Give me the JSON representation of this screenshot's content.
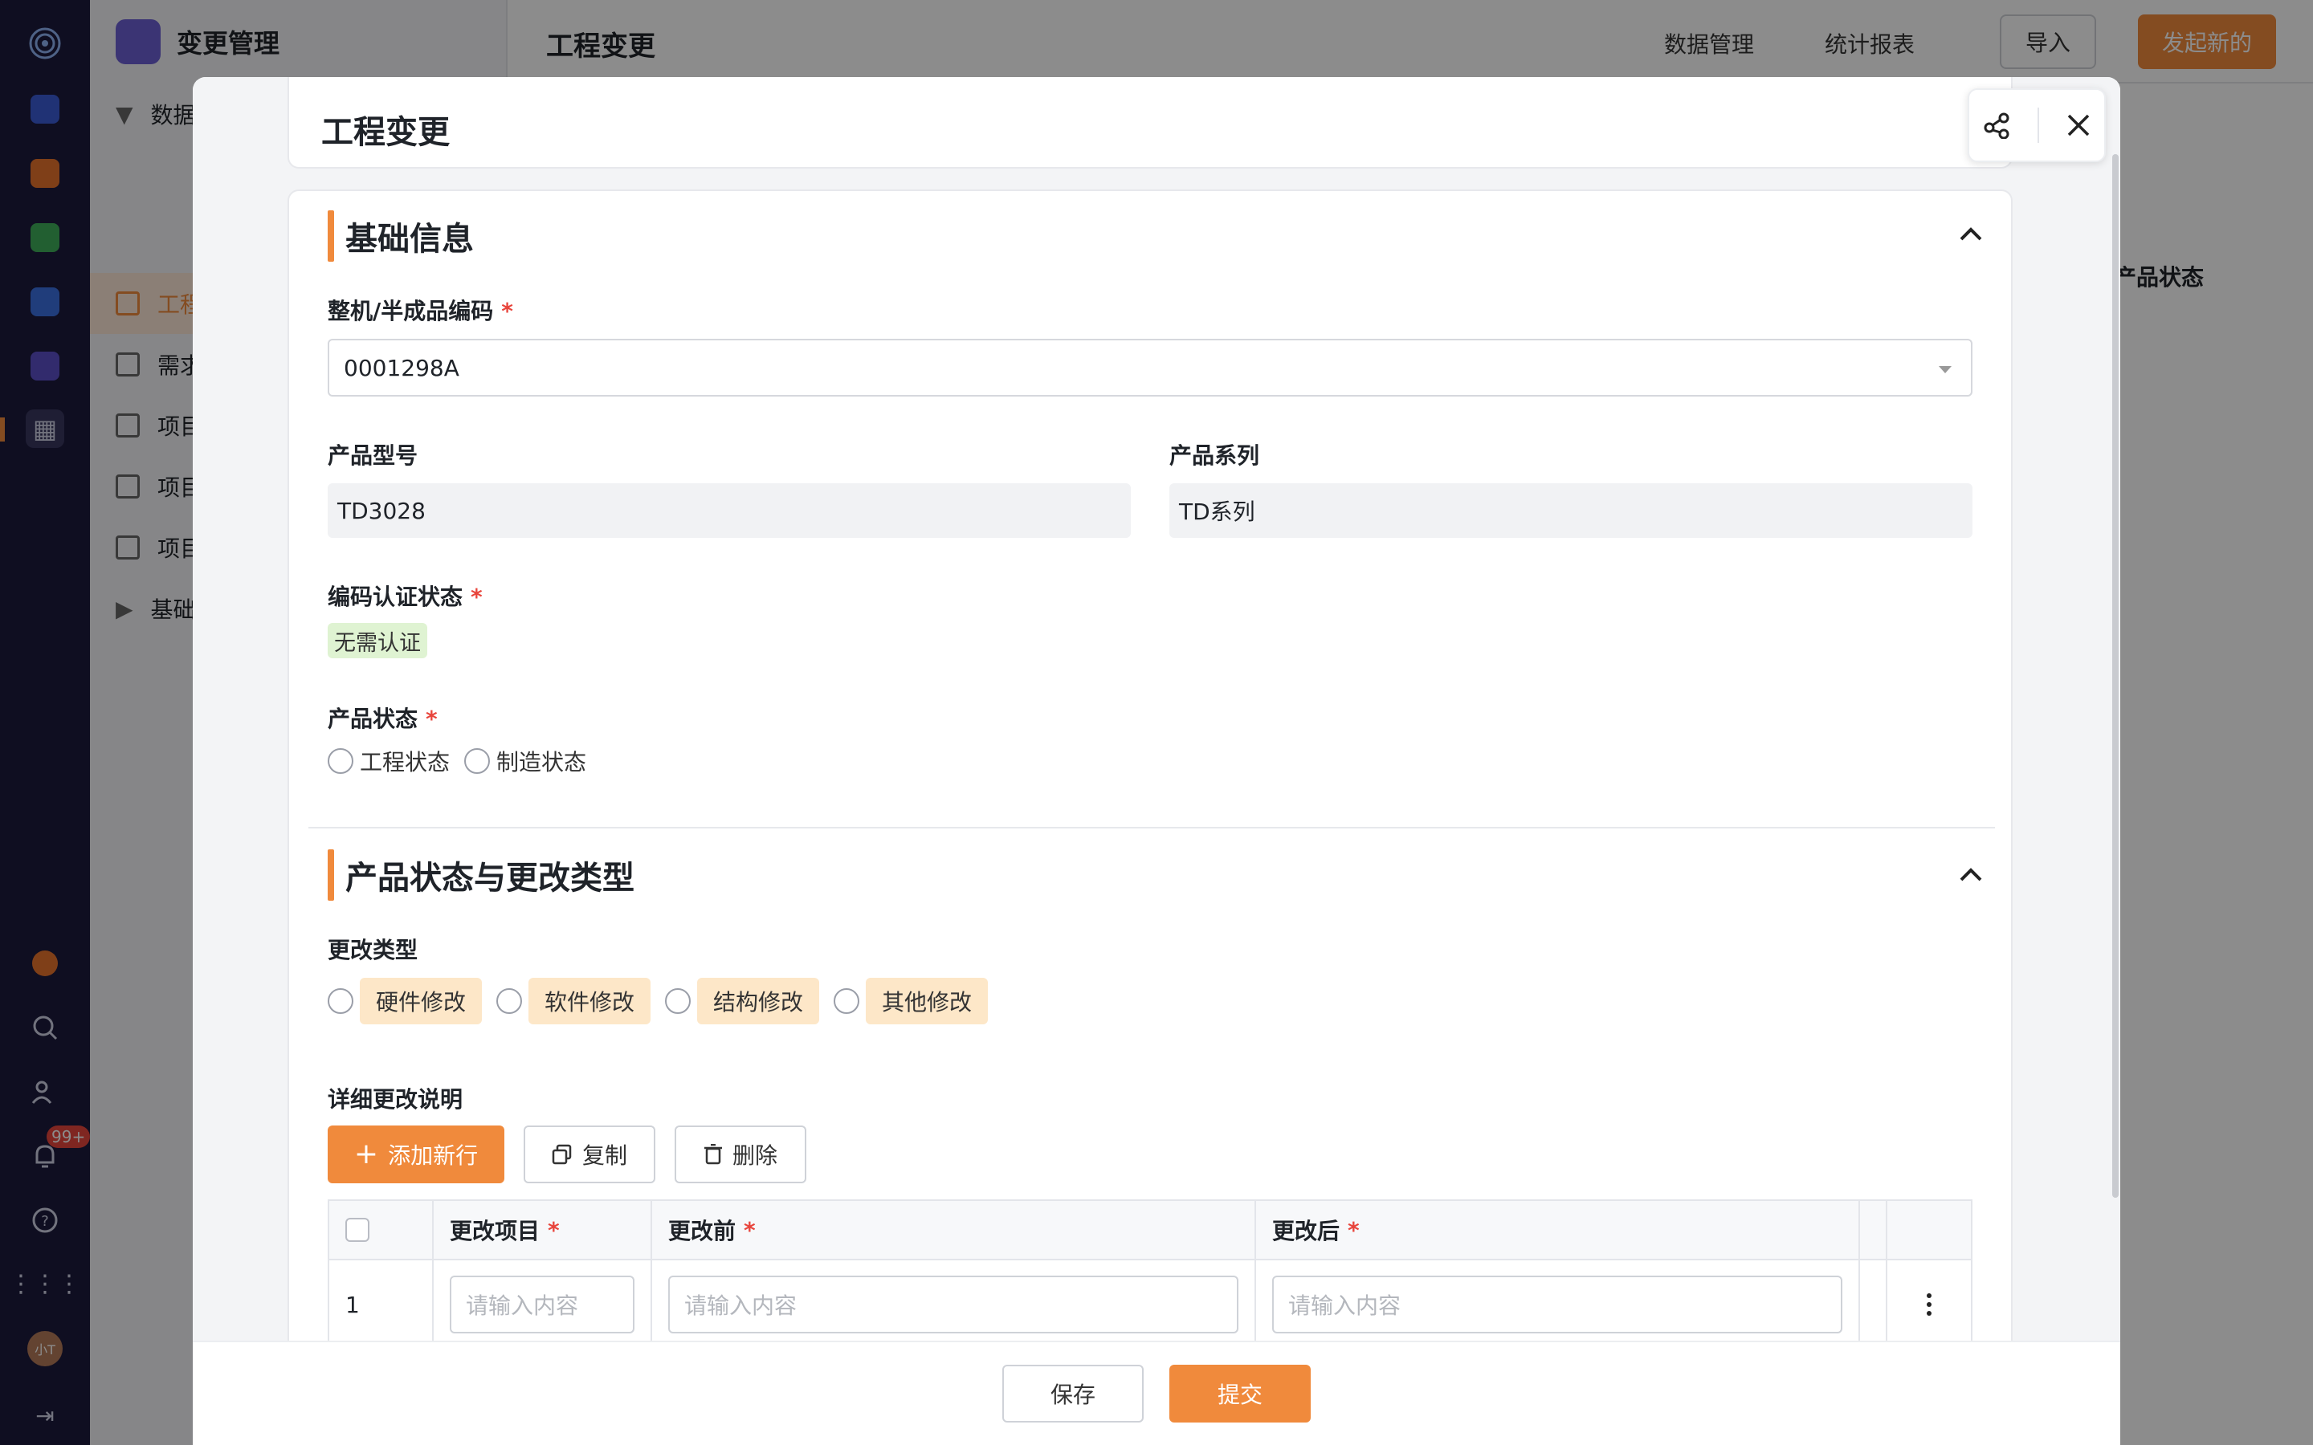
{
  "app": {
    "name": "变更管理",
    "nav_items": [
      {
        "label": "数据",
        "active": false
      },
      {
        "label": "工程",
        "active": true
      },
      {
        "label": "需求",
        "active": false
      },
      {
        "label": "项目",
        "active": false
      },
      {
        "label": "项目",
        "active": false
      },
      {
        "label": "项目",
        "active": false
      },
      {
        "label": "基础",
        "active": false
      }
    ],
    "notification_badge": "99+",
    "avatar_initials": "小T"
  },
  "topbar": {
    "page_title": "工程变更",
    "data_manage": "数据管理",
    "stats_report": "统计报表",
    "import_label": "导入",
    "new_label": "发起新的",
    "bg_column": "产品状态"
  },
  "modal": {
    "title": "工程变更",
    "section_basic": "基础信息",
    "fields": {
      "code_label": "整机/半成品编码",
      "code_value": "0001298A",
      "model_label": "产品型号",
      "model_value": "TD3028",
      "series_label": "产品系列",
      "series_value": "TD系列",
      "cert_label": "编码认证状态",
      "cert_value": "无需认证",
      "status_label": "产品状态",
      "status_options": [
        "工程状态",
        "制造状态"
      ]
    },
    "section_change": "产品状态与更改类型",
    "change_type_label": "更改类型",
    "change_type_options": [
      "硬件修改",
      "软件修改",
      "结构修改",
      "其他修改"
    ],
    "detail_label": "详细更改说明",
    "buttons": {
      "add_row": "添加新行",
      "copy": "复制",
      "delete": "删除",
      "save": "保存",
      "submit": "提交"
    },
    "table": {
      "headers": [
        "更改项目",
        "更改前",
        "更改后"
      ],
      "rows": [
        {
          "index": "1",
          "placeholder": "请输入内容"
        }
      ]
    },
    "required_mark": "*"
  },
  "colors": {
    "accent": "#f08a3c",
    "required": "#e8453c",
    "tag_green": "#dff3d2",
    "tag_orange": "#fde7c8"
  }
}
